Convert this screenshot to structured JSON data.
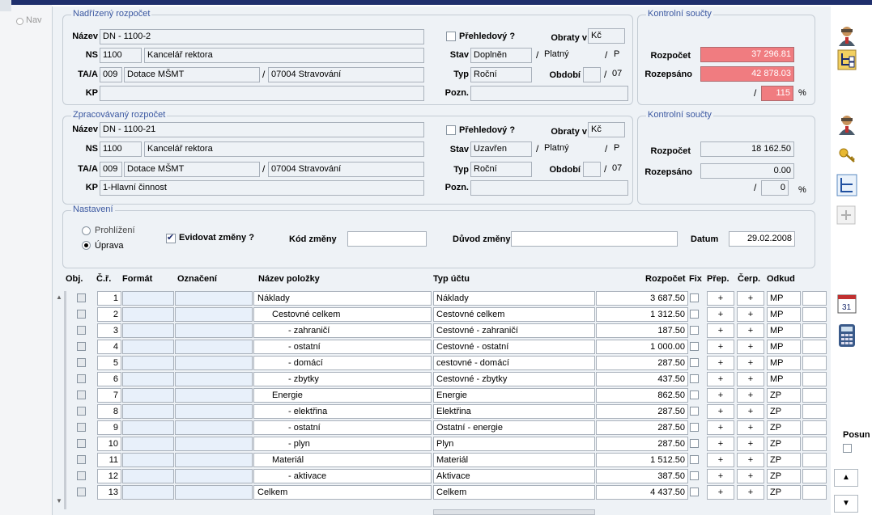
{
  "left_nav": {
    "label": "Nav"
  },
  "parent": {
    "legend": "Nadřízený rozpočet",
    "nazev_label": "Název",
    "nazev": "DN - 1100-2",
    "ns_label": "NS",
    "ns_code": "1100",
    "ns_name": "Kancelář rektora",
    "taa_label": "TA/A",
    "taa_code": "009",
    "taa_name": "Dotace MŠMT",
    "taa_extra": "07004 Stravování",
    "kp_label": "KP",
    "kp": "",
    "prehledovy_label": "Přehledový ?",
    "obraty_label": "Obraty v",
    "obraty": "Kč",
    "stav_label": "Stav",
    "stav": "Doplněn",
    "stav2": "Platný",
    "stav3": "P",
    "typ_label": "Typ",
    "typ": "Roční",
    "obdobi_label": "Období",
    "obdobi1": "",
    "obdobi2": "07",
    "pozn_label": "Pozn.",
    "pozn": ""
  },
  "parent_sums": {
    "legend": "Kontrolní součty",
    "rozpocet_label": "Rozpočet",
    "rozpocet": "37 296.81",
    "rozepsano_label": "Rozepsáno",
    "rozepsano": "42 878.03",
    "pct": "115",
    "pct_unit": "%"
  },
  "processed": {
    "legend": "Zpracovávaný rozpočet",
    "nazev_label": "Název",
    "nazev": "DN - 1100-21",
    "ns_label": "NS",
    "ns_code": "1100",
    "ns_name": "Kancelář rektora",
    "taa_label": "TA/A",
    "taa_code": "009",
    "taa_name": "Dotace MŠMT",
    "taa_extra": "07004 Stravování",
    "kp_label": "KP",
    "kp": "1-Hlavní činnost",
    "prehledovy_label": "Přehledový ?",
    "obraty_label": "Obraty v",
    "obraty": "Kč",
    "stav_label": "Stav",
    "stav": "Uzavřen",
    "stav2": "Platný",
    "stav3": "P",
    "typ_label": "Typ",
    "typ": "Roční",
    "obdobi_label": "Období",
    "obdobi1": "",
    "obdobi2": "07",
    "pozn_label": "Pozn.",
    "pozn": ""
  },
  "processed_sums": {
    "legend": "Kontrolní součty",
    "rozpocet_label": "Rozpočet",
    "rozpocet": "18 162.50",
    "rozepsano_label": "Rozepsáno",
    "rozepsano": "0.00",
    "pct": "0",
    "pct_unit": "%"
  },
  "settings": {
    "legend": "Nastavení",
    "mode_view": "Prohlížení",
    "mode_edit": "Úprava",
    "evidovat_label": "Evidovat změny ?",
    "kod_label": "Kód změny",
    "kod": "",
    "duvod_label": "Důvod změny",
    "duvod": "",
    "datum_label": "Datum",
    "datum": "29.02.2008"
  },
  "table": {
    "headers": {
      "obj": "Obj.",
      "cr": "Č.ř.",
      "format": "Formát",
      "oznaceni": "Označení",
      "nazev": "Název položky",
      "typ": "Typ účtu",
      "rozpocet": "Rozpočet",
      "fix": "Fix",
      "prep": "Přep.",
      "cerp": "Čerp.",
      "odkud": "Odkud"
    },
    "rows": [
      {
        "cr": "1",
        "nazev": "Náklady",
        "typ": "Náklady",
        "rozpocet": "3 687.50",
        "prep": "+",
        "cerp": "+",
        "odkud": "MP",
        "indent": 0,
        "pink": false
      },
      {
        "cr": "2",
        "nazev": "Cestovné celkem",
        "typ": "Cestovné celkem",
        "rozpocet": "1 312.50",
        "prep": "+",
        "cerp": "+",
        "odkud": "MP",
        "indent": 1,
        "pink": true
      },
      {
        "cr": "3",
        "nazev": "- zahraničí",
        "typ": "Cestovné - zahraničí",
        "rozpocet": "187.50",
        "prep": "+",
        "cerp": "+",
        "odkud": "MP",
        "indent": 2,
        "pink": true
      },
      {
        "cr": "4",
        "nazev": "- ostatní",
        "typ": "Cestovné - ostatní",
        "rozpocet": "1 000.00",
        "prep": "+",
        "cerp": "+",
        "odkud": "MP",
        "indent": 2,
        "pink": true
      },
      {
        "cr": "5",
        "nazev": "- domácí",
        "typ": "cestovné - domácí",
        "rozpocet": "287.50",
        "prep": "+",
        "cerp": "+",
        "odkud": "MP",
        "indent": 2,
        "pink": true
      },
      {
        "cr": "6",
        "nazev": "- zbytky",
        "typ": "Cestovné - zbytky",
        "rozpocet": "437.50",
        "prep": "+",
        "cerp": "+",
        "odkud": "MP",
        "indent": 2,
        "pink": true
      },
      {
        "cr": "7",
        "nazev": "Energie",
        "typ": "Energie",
        "rozpocet": "862.50",
        "prep": "+",
        "cerp": "+",
        "odkud": "ZP",
        "indent": 1,
        "pink": true
      },
      {
        "cr": "8",
        "nazev": "- elektřina",
        "typ": "Elektřina",
        "rozpocet": "287.50",
        "prep": "+",
        "cerp": "+",
        "odkud": "ZP",
        "indent": 2,
        "pink": true
      },
      {
        "cr": "9",
        "nazev": "- ostatní",
        "typ": "Ostatní - energie",
        "rozpocet": "287.50",
        "prep": "+",
        "cerp": "+",
        "odkud": "ZP",
        "indent": 2,
        "pink": true
      },
      {
        "cr": "10",
        "nazev": "- plyn",
        "typ": "Plyn",
        "rozpocet": "287.50",
        "prep": "+",
        "cerp": "+",
        "odkud": "ZP",
        "indent": 2,
        "pink": true
      },
      {
        "cr": "11",
        "nazev": "Materiál",
        "typ": "Materiál",
        "rozpocet": "1 512.50",
        "prep": "+",
        "cerp": "+",
        "odkud": "ZP",
        "indent": 1,
        "pink": true
      },
      {
        "cr": "12",
        "nazev": "- aktivace",
        "typ": "Aktivace",
        "rozpocet": "387.50",
        "prep": "+",
        "cerp": "+",
        "odkud": "ZP",
        "indent": 2,
        "pink": true
      },
      {
        "cr": "13",
        "nazev": "Celkem",
        "typ": "Celkem",
        "rozpocet": "4 437.50",
        "prep": "+",
        "cerp": "+",
        "odkud": "ZP",
        "indent": 0,
        "pink": true
      }
    ]
  },
  "right": {
    "posun_label": "Posun"
  }
}
